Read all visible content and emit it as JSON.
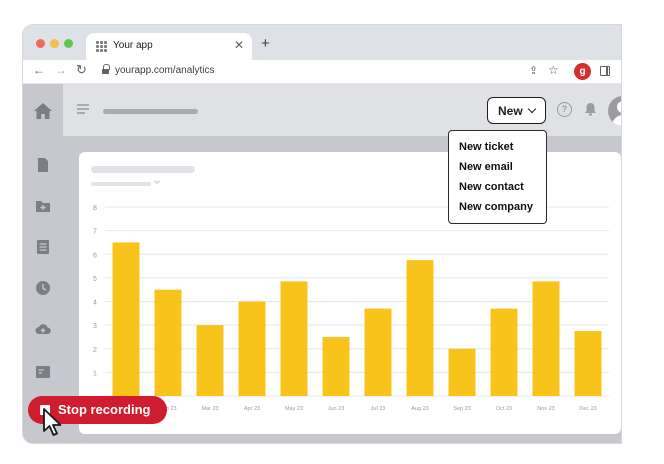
{
  "browser": {
    "tab_title": "Your app",
    "tab_close": "✕",
    "new_tab": "+",
    "url": "yourapp.com/analytics",
    "nav": {
      "back": "←",
      "forward": "→",
      "reload": "↻"
    },
    "icons": {
      "share": "share-icon",
      "bookmark": "star-icon",
      "extension": "extension-icon",
      "side_panel": "side-panel-icon"
    },
    "extension_badge": "g",
    "share_glyph": "⇪",
    "star_glyph": "☆"
  },
  "app": {
    "new_button_label": "New",
    "help_glyph": "?",
    "sidebar_icons": [
      "home-icon",
      "document-icon",
      "folder-icon",
      "list-icon",
      "clock-icon",
      "cloud-upload-icon",
      "card-icon"
    ],
    "dropdown_items": [
      "New ticket",
      "New email",
      "New contact",
      "New company"
    ]
  },
  "recording": {
    "label": "Stop recording"
  },
  "colors": {
    "bar": "#f8c41c",
    "recording": "#cf1c2e",
    "sidebar": "#c6c8cd",
    "grid": "#e6e7ea",
    "tick": "#9a9ca1"
  },
  "chart_data": {
    "type": "bar",
    "categories": [
      "Jan 23",
      "Feb 23",
      "Mar 23",
      "Apr 23",
      "May 23",
      "Jun 23",
      "Jul 23",
      "Aug 23",
      "Sep 23",
      "Oct 23",
      "Nov 23",
      "Dec 23"
    ],
    "values": [
      6.5,
      4.5,
      3.0,
      4.0,
      4.85,
      2.5,
      3.7,
      5.75,
      2.0,
      3.7,
      4.85,
      2.75
    ],
    "yticks": [
      1,
      2,
      3,
      4,
      5,
      6,
      7,
      8
    ],
    "ylim": [
      0,
      8
    ],
    "grid": true,
    "title": "",
    "xlabel": "",
    "ylabel": ""
  }
}
